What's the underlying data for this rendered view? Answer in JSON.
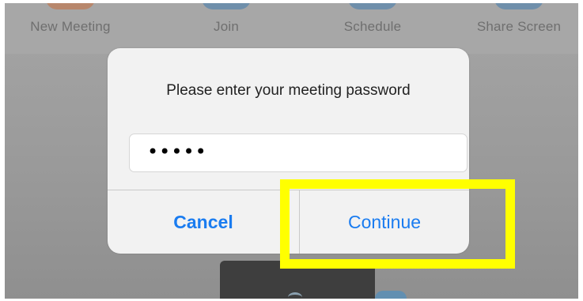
{
  "toolbar": {
    "items": [
      {
        "label": "New Meeting",
        "icon": "new-meeting-icon",
        "color": "#c9784f"
      },
      {
        "label": "Join",
        "icon": "join-icon",
        "color": "#3f82c0"
      },
      {
        "label": "Schedule",
        "icon": "schedule-icon",
        "color": "#3f82c0"
      },
      {
        "label": "Share Screen",
        "icon": "share-screen-icon",
        "color": "#3f82c0"
      }
    ]
  },
  "dialog": {
    "title": "Please enter your meeting password",
    "password_value": "•••••",
    "cancel_label": "Cancel",
    "continue_label": "Continue"
  },
  "colors": {
    "accent": "#1a7cf0",
    "highlight": "#ffff00",
    "dialog_bg": "#f2f2f2"
  }
}
